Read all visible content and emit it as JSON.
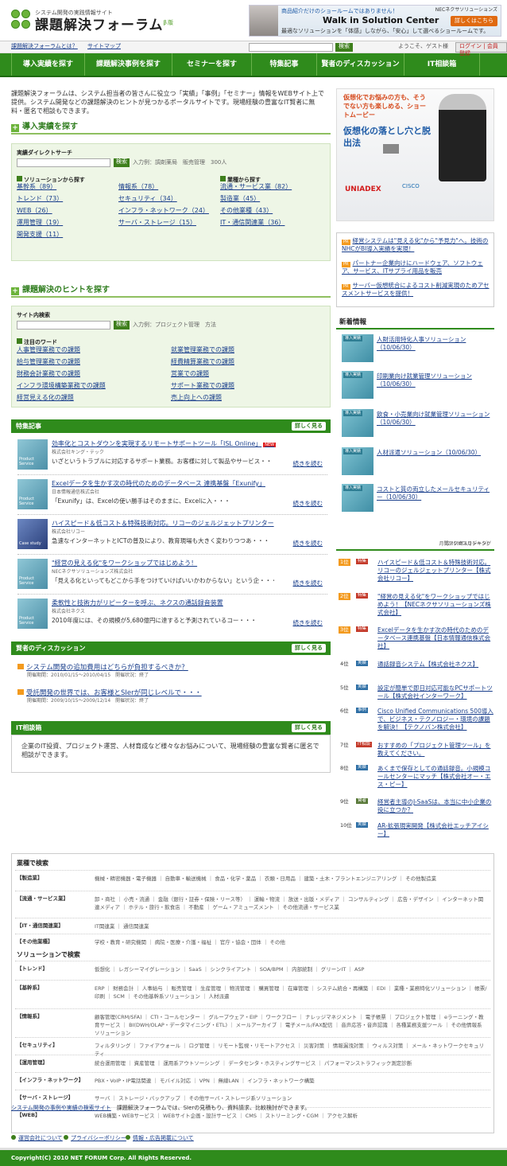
{
  "header": {
    "logo_sub": "システム開発の実践情報サイト",
    "logo_main": "課題解決フォーラム",
    "logo_beta": "β版",
    "banner_t1": "商品紹介だけのショールームではありません！",
    "banner_t2": "Walk in Solution Center",
    "banner_t3": "最適なソリューションを「体感」しながら、「安心」して選べるショールームです。",
    "banner_co": "NECネクサソリューションズ",
    "banner_btn": "詳しくはこちら"
  },
  "util": {
    "about": "課題解決フォーラムとは？",
    "sitemap": "サイトマップ",
    "search_btn": "検索",
    "welcome": "ようこそ、ゲスト様",
    "login": "ログイン",
    "register": "会員登録"
  },
  "nav": [
    "導入実績を探す",
    "課題解決事例を探す",
    "セミナーを探す",
    "特集記事",
    "賢者のディスカッション",
    "IT相談箱"
  ],
  "intro": "課題解決フォーラムは、システム担当者の皆さんに役立つ「実績」「事例」「セミナー」情報をWEBサイト上で提供。システム開発などの課題解決のヒントが見つかるポータルサイトです。現場経験の豊富なIT賢者に無料・匿名で相談もできます。",
  "s1": {
    "title": "導入実績を探す",
    "direct": "実績ダイレクトサーチ",
    "btn": "検索",
    "hint": "入力例：調剤薬局　販売管理　300人",
    "sol_h": "ソリューションから探す",
    "ind_h": "業種から探す",
    "sol": [
      "基幹系（89）",
      "トレンド（73）",
      "WEB（26）",
      "運用管理（19）",
      "開発支援（11）",
      "情報系（78）",
      "セキュリティ（34）",
      "インフラ・ネットワーク（24）",
      "サーバ・ストレージ（15）"
    ],
    "ind": [
      "流通・サービス業（82）",
      "製造業（45）",
      "その他業種（43）",
      "IT・通信関連業（36）"
    ]
  },
  "s2": {
    "title": "課題解決のヒントを探す",
    "site": "サイト内検索",
    "btn": "検索",
    "hint": "入力例：プロジェクト管理　方法",
    "kw_h": "注目のワード",
    "kw": [
      "人事管理業務での課題",
      "給与管理業務での課題",
      "財務会計業務での課題",
      "インフラ環境構築業務での課題",
      "経営見える化の課題",
      "就業管理業務での課題",
      "経費精算業務での課題",
      "営業での課題",
      "サポート業務での課題",
      "売上向上への課題"
    ]
  },
  "feature": {
    "title": "特集記事",
    "more": "詳しく見る",
    "read": "続きを読む",
    "items": [
      {
        "tag": "Product Service",
        "t": "効率化とコストダウンを実現するリモートサポートツール「ISL Online」",
        "new": "NEW",
        "co": "株式会社キング・テック",
        "d": "いざというトラブルに対応するサポート業務。お客様に対して製品やサービス・・・"
      },
      {
        "tag": "Product Service",
        "t": "Excelデータを生かす次の時代のためのデータベース 連携基盤「Exunify」",
        "new": "",
        "co": "日本情報通信株式会社",
        "d": "「Exunify」は、Excelの使い勝手はそのままに、Excelに入・・・"
      },
      {
        "tag": "Case study",
        "t": "ハイスピード＆低コスト＆特殊技術対応。リコーのジェルジェットプリンター",
        "new": "",
        "co": "株式会社リコー",
        "d": "急速なインターネットとICTの普及により、教育現場も大きく変わりつつあ・・・"
      },
      {
        "tag": "Product Service",
        "t": "\"経営の見える化\"をワークショップではじめよう！",
        "new": "",
        "co": "NECネクサソリューションズ株式会社",
        "d": "「見える化といってもどこから手をつけていけばいいかわからない」という企・・・"
      },
      {
        "tag": "Product Service",
        "t": "柔軟性と技術力がリピーターを呼ぶ、ネクスの通話録音装置",
        "new": "",
        "co": "株式会社ネクス",
        "d": "2010年度には、その規模が5,680億円に達すると予測されているコー・・・"
      }
    ]
  },
  "disc": {
    "title": "賢者のディスカッション",
    "more": "詳しく見る",
    "items": [
      {
        "t": "システム開発の追加費用はどちらが負担するべきか？",
        "m": "開催期間：2010/01/15～2010/04/15　開催状況：終了"
      },
      {
        "t": "受託開発の世界では、お客様とSIerが同じレベルで・・・",
        "m": "開催期間：2009/10/15～2009/12/14　開催状況：終了"
      }
    ]
  },
  "it": {
    "title": "IT相談箱",
    "more": "詳しく見る",
    "text": "企業のIT投資、プロジェクト運営、人材育成など様々なお悩みについて、現場経験の豊富な賢者に匿名で相談ができます。"
  },
  "ad": {
    "a1": "仮想化でお悩みの方も、そうでない方も楽しめる、ショートムービー",
    "a2": "仮想化の落とし穴と脱出法",
    "u": "UNIADEX",
    "c": "CISCO"
  },
  "pr": [
    {
      "b": "PR",
      "t": "経営システムは\"見える化\"から\"予見力\"へ。技術のNHCがBI導入実績を実現！"
    },
    {
      "b": "PR",
      "t": "パートナー企業向けにハードウェア、ソフトウェア、サービス、ITサプライ用品を販売"
    },
    {
      "b": "PR",
      "t": "サーバー仮想統合によるコスト削減実現のためアセスメントサービスを提供！"
    }
  ],
  "news": {
    "title": "新着情報",
    "tag": "導入実績",
    "items": [
      "人財活用特化人事ソリューション（10/06/30）",
      "印刷業向け就業管理ソリューション（10/06/30）",
      "飲食・小売業向け就業管理ソリューション（10/06/30）",
      "人材派遣ソリューション（10/06/30）",
      "コストと質の両立したメールセキュリティー（10/06/30）"
    ]
  },
  "rank": {
    "title": "月間アクセスランキング",
    "note": "（2010年5月データ）",
    "items": [
      {
        "n": "1位",
        "c": "特集",
        "t": "ハイスピード＆低コスト＆特殊技術対応。リコーのジェルジェットプリンター【株式会社リコー】"
      },
      {
        "n": "2位",
        "c": "特集",
        "t": "\"経営の見える化\"をワークショップではじめよう！【NECネクサソリューションズ株式会社】"
      },
      {
        "n": "3位",
        "c": "特集",
        "t": "Excelデータを生かす次の時代のためのデータベース連携基盤【日本情報通信株式会社】"
      },
      {
        "n": "4位",
        "c": "実績",
        "t": "通話録音システム【株式会社ネクス】"
      },
      {
        "n": "5位",
        "c": "実績",
        "t": "設定が簡単で即日対応可能なPCサポートツール【株式会社インターワーク】"
      },
      {
        "n": "6位",
        "c": "事例",
        "t": "Cisco Unified Communications 500導入で、ビジネス・テクノロジー・環境の課題を解決！【テクノバン株式会社】"
      },
      {
        "n": "7位",
        "c": "IT相談",
        "t": "おすすめの「プロジェクト管理ツール」を教えてください。"
      },
      {
        "n": "8位",
        "c": "実績",
        "t": "あくまで保存としての通話録音。小規模コールセンターにマッチ【株式会社オー・エス・ピー】"
      },
      {
        "n": "9位",
        "c": "賢者",
        "t": "経営者主導のJ-SaaSは、本当に中小企業の役に立つか？"
      },
      {
        "n": "10位",
        "c": "実績",
        "t": "AR-拡張現実開発【株式会社エッチアイシー】"
      }
    ]
  },
  "index": {
    "h1": "業種で検索",
    "h2": "ソリューションで検索",
    "rows1": [
      {
        "k": "【製造業】",
        "v": "機械・精密機器・電子機器 ｜ 自動車・輸送機械 ｜ 食品・化学・薬品 ｜ 衣類・日用品 ｜ 建築・土木・プラントエンジニアリング ｜ その他製造業"
      },
      {
        "k": "【流通・サービス業】",
        "v": "卸・商社 ｜ 小売・流通 ｜ 金融（銀行・証券・保険・リース等） ｜ 運輸・物流 ｜ 放送・出版・メディア ｜ コンサルティング ｜ 広告・デザイン ｜ インターネット関連メディア ｜ ホテル・旅行・飲食店 ｜ 不動産 ｜ ゲーム・アミューズメント ｜ その他流通・サービス業"
      },
      {
        "k": "【IT・通信関連業】",
        "v": "IT関連業 ｜ 通信関連業"
      },
      {
        "k": "【その他業種】",
        "v": "学校・教育・研究機関 ｜ 病院・医療・介護・福祉 ｜ 官庁・協会・団体 ｜ その他"
      }
    ],
    "rows2": [
      {
        "k": "【トレンド】",
        "v": "仮想化 ｜ レガシーマイグレーション ｜ SaaS ｜ シンクライアント ｜ SOA/BPM ｜ 内部統制 ｜ グリーンIT ｜ ASP"
      },
      {
        "k": "【基幹系】",
        "v": "ERP ｜ 財務会計 ｜ 人事給与 ｜ 販売管理 ｜ 生産管理 ｜ 物流管理 ｜ 購買管理 ｜ 在庫管理 ｜ システム統合・再構築 ｜ EDI ｜ 業種・業務特化ソリューション ｜ 帳票/印刷 ｜ SCM ｜ その他基幹系ソリューション ｜ 人材派遣"
      },
      {
        "k": "【情報系】",
        "v": "顧客管理(CRM/SFA) ｜ CTI・コールセンター ｜ グループウェア・EIP ｜ ワークフロー ｜ ナレッジマネジメント ｜ 電子帳票 ｜ プロジェクト管理 ｜ eラーニング・教育サービス ｜ BI(DWH/OLAP・データマイニング・ETL) ｜ メールアーカイブ ｜ 電子メール/FAX配信 ｜ 音声応答・音声認識 ｜ 各種業務支援ツール ｜ その他情報系ソリューション"
      },
      {
        "k": "【セキュリティ】",
        "v": "フィルタリング ｜ ファイアウォール ｜ ログ管理 ｜ リモート監視・リモートアクセス ｜ 災害対策 ｜ 情報漏洩対策 ｜ ウィルス対策 ｜ メール・ネットワークセキュリティ"
      },
      {
        "k": "【運用管理】",
        "v": "統合運用管理 ｜ 資産管理 ｜ 運用系アウトソーシング ｜ データセンタ・ホスティングサービス ｜ パフォーマンストラフィック測定診断"
      },
      {
        "k": "【インフラ・ネットワーク】",
        "v": "PBX・VoIP・IP電話関連 ｜ モバイル対応 ｜ VPN ｜ 無線LAN ｜ インフラ・ネットワーク構築"
      },
      {
        "k": "【サーバ・ストレージ】",
        "v": "サーバ ｜ ストレージ・バックアップ ｜ その他サーバ・ストレージ系ソリューション"
      },
      {
        "k": "【WEB】",
        "v": "WEB構築・WEBサービス ｜ WEBサイト企画・設計サービス ｜ CMS ｜ ストリーミング・CGM ｜ アクセス解析"
      }
    ]
  },
  "crumb": {
    "a": "システム開発の事例や実績の検索サイト",
    "b": "課題解決フォーラムでは、SIerの見積もり、資料請求、比較検討ができます。"
  },
  "footer": {
    "l1": "運営会社について",
    "l2": "プライバシーポリシー",
    "l3": "情報・広告掲載について",
    "copy": "Copyright(C) 2010 NET FORUM Corp. All Rights Reserved."
  }
}
